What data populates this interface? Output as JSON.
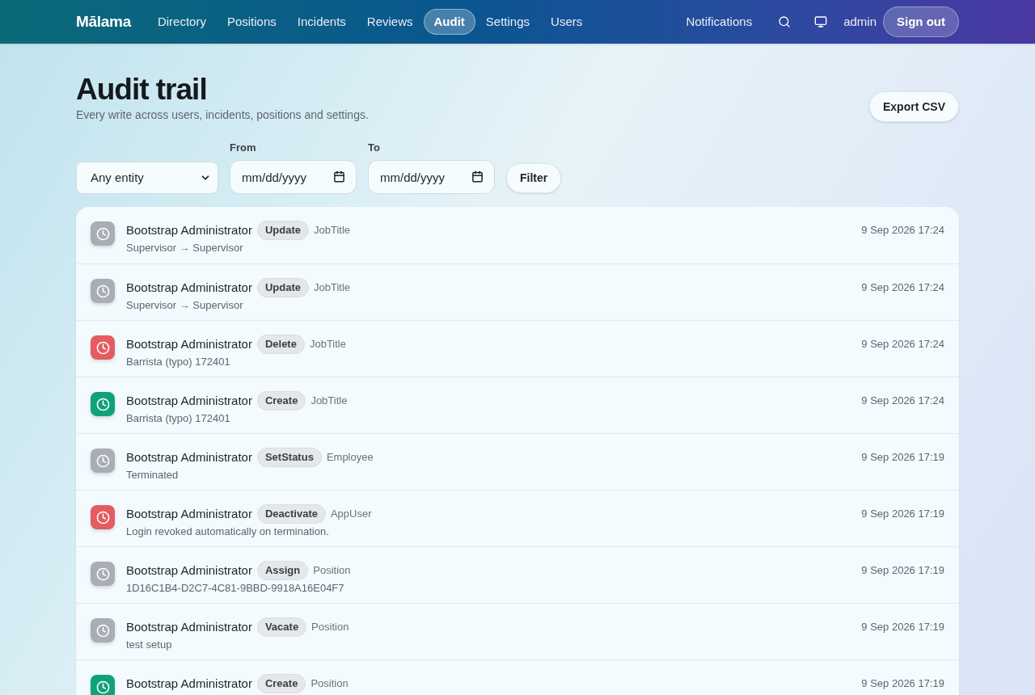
{
  "nav": {
    "brand": "Mālama",
    "links": [
      {
        "label": "Directory",
        "selected": false
      },
      {
        "label": "Positions",
        "selected": false
      },
      {
        "label": "Incidents",
        "selected": false
      },
      {
        "label": "Reviews",
        "selected": false
      },
      {
        "label": "Audit",
        "selected": true
      },
      {
        "label": "Settings",
        "selected": false
      },
      {
        "label": "Users",
        "selected": false
      }
    ],
    "notifications": "Notifications",
    "user": "admin",
    "sign_out": "Sign out"
  },
  "header": {
    "title": "Audit trail",
    "subtitle": "Every write across users, incidents, positions and settings.",
    "export_button": "Export CSV"
  },
  "filters": {
    "entity_select": {
      "value": "Any entity"
    },
    "from": {
      "label": "From",
      "placeholder": "mm/dd/yyyy"
    },
    "to": {
      "label": "To",
      "placeholder": "mm/dd/yyyy"
    },
    "filter_button": "Filter"
  },
  "entries": [
    {
      "actor": "Bootstrap Administrator",
      "action": "Update",
      "entity": "JobTitle",
      "detail": "Supervisor → Supervisor",
      "time": "9 Sep 2026 17:24",
      "color": "#a9adb4"
    },
    {
      "actor": "Bootstrap Administrator",
      "action": "Update",
      "entity": "JobTitle",
      "detail": "Supervisor → Supervisor",
      "time": "9 Sep 2026 17:24",
      "color": "#a9adb4"
    },
    {
      "actor": "Bootstrap Administrator",
      "action": "Delete",
      "entity": "JobTitle",
      "detail": "Barrista (typo) 172401",
      "time": "9 Sep 2026 17:24",
      "color": "#e45c5f"
    },
    {
      "actor": "Bootstrap Administrator",
      "action": "Create",
      "entity": "JobTitle",
      "detail": "Barrista (typo) 172401",
      "time": "9 Sep 2026 17:24",
      "color": "#10a27a"
    },
    {
      "actor": "Bootstrap Administrator",
      "action": "SetStatus",
      "entity": "Employee",
      "detail": "Terminated",
      "time": "9 Sep 2026 17:19",
      "color": "#a9adb4"
    },
    {
      "actor": "Bootstrap Administrator",
      "action": "Deactivate",
      "entity": "AppUser",
      "detail": "Login revoked automatically on termination.",
      "time": "9 Sep 2026 17:19",
      "color": "#e45c5f"
    },
    {
      "actor": "Bootstrap Administrator",
      "action": "Assign",
      "entity": "Position",
      "detail": "1D16C1B4-D2C7-4C81-9BBD-9918A16E04F7",
      "time": "9 Sep 2026 17:19",
      "color": "#a9adb4"
    },
    {
      "actor": "Bootstrap Administrator",
      "action": "Vacate",
      "entity": "Position",
      "detail": "test setup",
      "time": "9 Sep 2026 17:19",
      "color": "#a9adb4"
    },
    {
      "actor": "Bootstrap Administrator",
      "action": "Create",
      "entity": "Position",
      "time": "9 Sep 2026 17:19",
      "color": "#10a27a"
    }
  ]
}
